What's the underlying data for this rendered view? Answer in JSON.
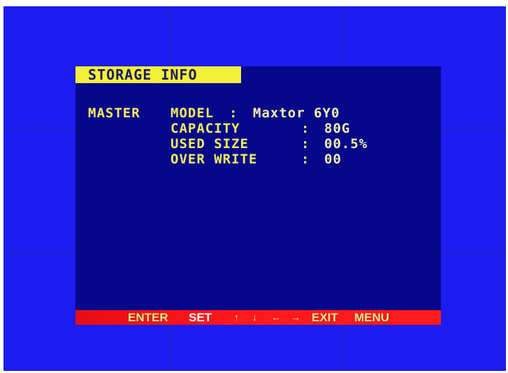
{
  "osd": {
    "title": "STORAGE INFO",
    "master_label": "MASTER",
    "rows": [
      {
        "label": "MODEL",
        "sep": ":",
        "value": "Maxtor 6Y0"
      },
      {
        "label": "CAPACITY",
        "sep": ":",
        "value": "80G"
      },
      {
        "label": "USED SIZE",
        "sep": ":",
        "value": "00.5%"
      },
      {
        "label": "OVER WRITE",
        "sep": ":",
        "value": "00"
      }
    ]
  },
  "footer": {
    "enter_label": "ENTER",
    "set_label": "SET",
    "up_arrow": "↑",
    "down_arrow": "↓",
    "left_arrow": "←",
    "right_arrow": "→",
    "exit_label": "EXIT",
    "menu_label": "MENU"
  },
  "colors": {
    "screen_background": "#1c1cf0",
    "panel_background": "#07078a",
    "title_background": "#f3f03a",
    "footer_background": "#ff1a1a",
    "label_text": "#f2ee5a"
  }
}
